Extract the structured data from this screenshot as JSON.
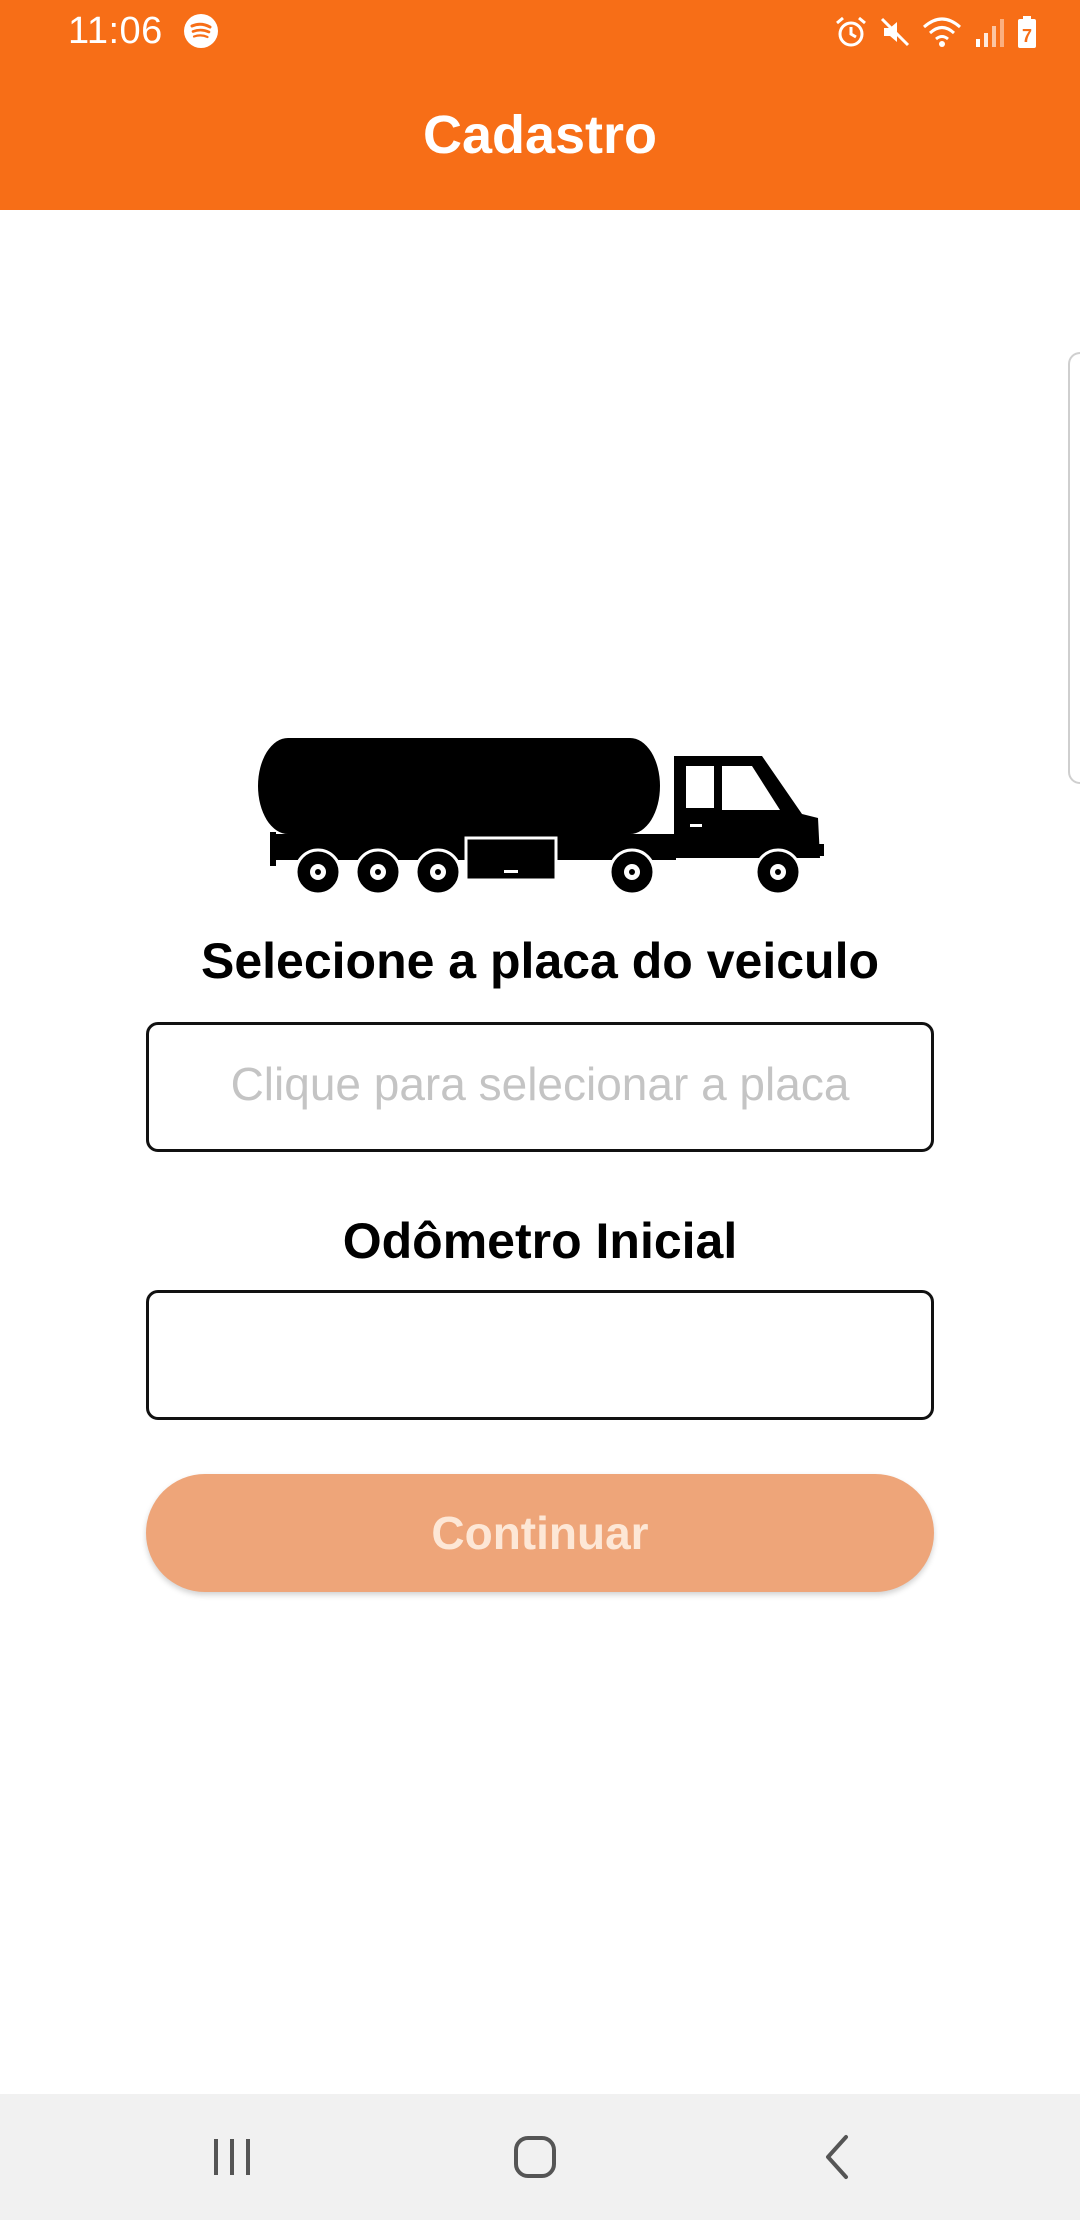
{
  "status_bar": {
    "time": "11:06",
    "icons": [
      "spotify-icon",
      "alarm-icon",
      "mute-icon",
      "wifi-icon",
      "signal-icon",
      "battery-icon"
    ],
    "battery_level": "7"
  },
  "app_bar": {
    "title": "Cadastro",
    "color": "#f76e17"
  },
  "form": {
    "illustration": "tanker-truck-icon",
    "plate_label": "Selecione a placa do veiculo",
    "plate_placeholder": "Clique para selecionar a placa",
    "odometer_label": "Odômetro Inicial",
    "odometer_value": "",
    "continue_label": "Continuar",
    "continue_color": "#eea579"
  },
  "nav_bar": {
    "buttons": [
      "recents-icon",
      "home-icon",
      "back-icon"
    ]
  }
}
